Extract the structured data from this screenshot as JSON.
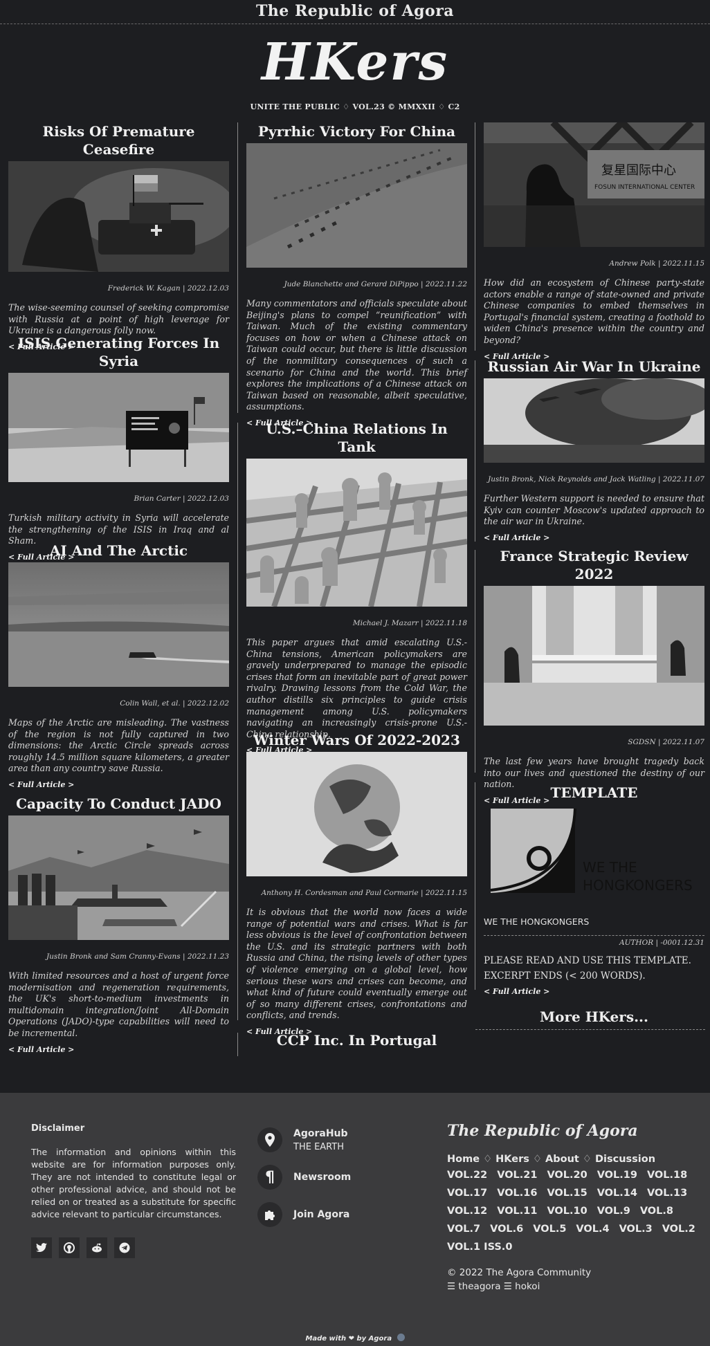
{
  "site": {
    "top_brand": "The Republic of Agora",
    "logo": "HKers",
    "edition": "UNITE THE PUBLIC ♢ VOL.23 © MMXXII ♢ C2"
  },
  "col1": [
    {
      "title": "Risks Of Premature Ceasefire",
      "byline": "Frederick W. Kagan | 2022.12.03",
      "summary": "The wise-seeming counsel of seeking compromise with Russia at a point of high leverage for Ukraine is a dangerous folly now.",
      "more": "< Full Article >"
    },
    {
      "title": "ISIS Generating Forces In Syria",
      "byline": "Brian Carter | 2022.12.03",
      "summary": "Turkish military activity in Syria will accelerate the strengthening of the ISIS in Iraq and al Sham.",
      "more": "< Full Article >"
    },
    {
      "title": "AI And The Arctic",
      "byline": "Colin Wall, et al. | 2022.12.02",
      "summary": "Maps of the Arctic are misleading. The vastness of the region is not fully captured in two dimensions: the Arctic Circle spreads across roughly 14.5 million square kilometers, a greater area than any country save Russia.",
      "more": "< Full Article >"
    },
    {
      "title": "Capacity To Conduct JADO",
      "byline": "Justin Bronk and Sam Cranny-Evans | 2022.11.23",
      "summary": "With limited resources and a host of urgent force modernisation and regeneration requirements, the UK's short-to-medium investments in multidomain integration/Joint All-Domain Operations (JADO)-type capabilities will need to be incremental.",
      "more": "< Full Article >"
    }
  ],
  "col2": [
    {
      "title": "Pyrrhic Victory For China",
      "byline": "Jude Blanchette and Gerard DiPippo | 2022.11.22",
      "summary": "Many commentators and officials speculate about Beijing's plans to compel “reunification” with Taiwan. Much of the existing commentary focuses on how or when a Chinese attack on Taiwan could occur, but there is little discussion of the nonmilitary consequences of such a scenario for China and the world. This brief explores the implications of a Chinese attack on Taiwan based on reasonable, albeit speculative, assumptions.",
      "more": "< Full Article >"
    },
    {
      "title": "U.S.–China Relations In Tank",
      "byline": "Michael J. Mazarr | 2022.11.18",
      "summary": "This paper argues that amid escalating U.S.-China tensions, American policymakers are gravely underprepared to manage the episodic crises that form an inevitable part of great power rivalry. Drawing lessons from the Cold War, the author distills six principles to guide crisis management among U.S. policymakers navigating an increasingly crisis-prone U.S.-China relationship.",
      "more": "< Full Article >"
    },
    {
      "title": "Winter Wars Of 2022-2023",
      "byline": "Anthony H. Cordesman and Paul Cormarie | 2022.11.15",
      "summary": "It is obvious that the world now faces a wide range of potential wars and crises. What is far less obvious is the level of confrontation between the U.S. and its strategic partners with both Russia and China, the rising levels of other types of violence emerging on a global level, how serious these wars and crises can become, and what kind of future could eventually emerge out of so many different crises, confrontations and conflicts, and trends.",
      "more": "< Full Article >"
    },
    {
      "title": "CCP Inc. In Portugal"
    }
  ],
  "col3": [
    {
      "byline": "Andrew Polk | 2022.11.15",
      "summary": "How did an ecosystem of Chinese party-state actors enable a range of state-owned and private Chinese companies to embed themselves in Portugal's financial system, creating a foothold to widen China's presence within the country and beyond?",
      "more": "< Full Article >",
      "sign_text": "复星国际中心",
      "sign_sub": "FOSUN INTERNATIONAL CENTER"
    },
    {
      "title": "Russian Air War In Ukraine",
      "byline": "Justin Bronk, Nick Reynolds and Jack Watling | 2022.11.07",
      "summary": "Further Western support is needed to ensure that Kyiv can counter Moscow's updated approach to the air war in Ukraine.",
      "more": "< Full Article >"
    },
    {
      "title": "France Strategic Review 2022",
      "byline": "SGDSN | 2022.11.07",
      "summary": "The last few years have brought tragedy back into our lives and questioned the destiny of our nation.",
      "more": "< Full Article >"
    }
  ],
  "template": {
    "title": "TEMPLATE",
    "logo_text_1": "WE THE",
    "logo_text_2": "HONGKONGERS",
    "name": "WE THE HONGKONGERS",
    "author": "AUTHOR | -0001.12.31",
    "line1": "PLEASE READ AND USE THIS TEMPLATE.",
    "line2": "EXCERPT ENDS (< 200 WORDS).",
    "more": "< Full Article >"
  },
  "more_hkers": "More HKers...",
  "footer": {
    "disclaimer_title": "Disclaimer",
    "disclaimer": "The information and opinions within this website are for information purposes only. They are not intended to constitute legal or other professional advice, and should not be relied on or treated as a substitute for specific advice relevant to particular circumstances.",
    "hub_title": "AgoraHub",
    "hub_sub": "THE EARTH",
    "newsroom": "Newsroom",
    "join": "Join Agora",
    "brand": "The Republic of Agora",
    "nav": [
      "Home",
      "HKers",
      "About",
      "Discussion"
    ],
    "nav_sep": "♢",
    "vols": [
      "VOL.22",
      "VOL.21",
      "VOL.20",
      "VOL.19",
      "VOL.18",
      "VOL.17",
      "VOL.16",
      "VOL.15",
      "VOL.14",
      "VOL.13",
      "VOL.12",
      "VOL.11",
      "VOL.10",
      "VOL.9",
      "VOL.8",
      "VOL.7",
      "VOL.6",
      "VOL.5",
      "VOL.4",
      "VOL.3",
      "VOL.2",
      "VOL.1 ISS.0"
    ],
    "copyright": "© 2022 The Agora Community",
    "links": "☰ theagora ☰ hokoi",
    "made_with": "Made with ❤ by Agora"
  }
}
